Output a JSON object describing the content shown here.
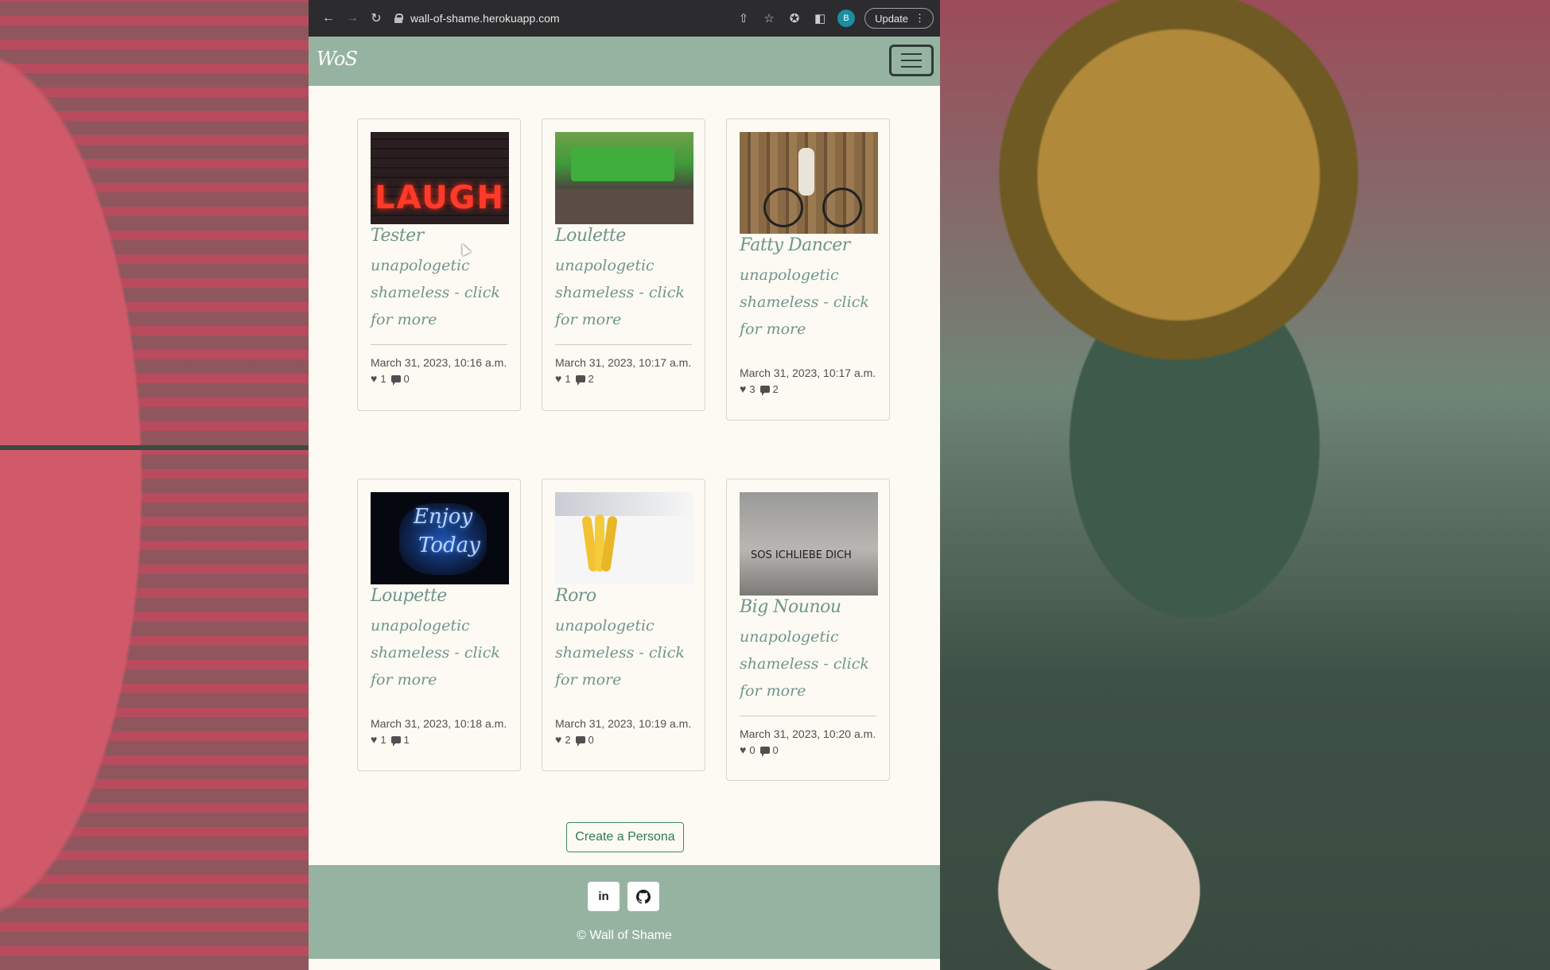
{
  "browser": {
    "url": "wall-of-shame.herokuapp.com",
    "profile_initial": "B",
    "update_label": "Update"
  },
  "site": {
    "brand": "WoS",
    "create_button": "Create a Persona",
    "copyright": "© Wall of Shame"
  },
  "personas": [
    {
      "name": "Tester",
      "description": "unapologetic shameless - click for more",
      "date": "March 31, 2023, 10:16 a.m.",
      "likes": "1",
      "comments": "0",
      "image": "laugh-neon-sign"
    },
    {
      "name": "Loulette",
      "description": "unapologetic shameless - click for more",
      "date": "March 31, 2023, 10:17 a.m.",
      "likes": "1",
      "comments": "2",
      "image": "green-machine"
    },
    {
      "name": "Fatty Dancer",
      "description": "unapologetic shameless - click for more",
      "date": "March 31, 2023, 10:17 a.m.",
      "likes": "3",
      "comments": "2",
      "image": "skeleton-bicycle"
    },
    {
      "name": "Loupette",
      "description": "unapologetic shameless - click for more",
      "date": "March 31, 2023, 10:18 a.m.",
      "likes": "1",
      "comments": "1",
      "image": "enjoy-today-neon"
    },
    {
      "name": "Roro",
      "description": "unapologetic shameless - click for more",
      "date": "March 31, 2023, 10:19 a.m.",
      "likes": "2",
      "comments": "0",
      "image": "bananas"
    },
    {
      "name": "Big Nounou",
      "description": "unapologetic shameless - click for more",
      "date": "March 31, 2023, 10:20 a.m.",
      "likes": "0",
      "comments": "0",
      "image": "sos-graffiti-wall"
    }
  ],
  "image_text": {
    "laugh": "LAUGH",
    "enjoy": "Enjoy",
    "today": "Today",
    "graffiti": "SOS ICHLIEBE DICH"
  },
  "social": {
    "linkedin": "in",
    "github_icon": "github-icon"
  },
  "colors": {
    "nav_bg": "#96b3a2",
    "page_bg": "#fdfaf3",
    "accent_text": "#6e958c",
    "button_green": "#2d7a52"
  }
}
